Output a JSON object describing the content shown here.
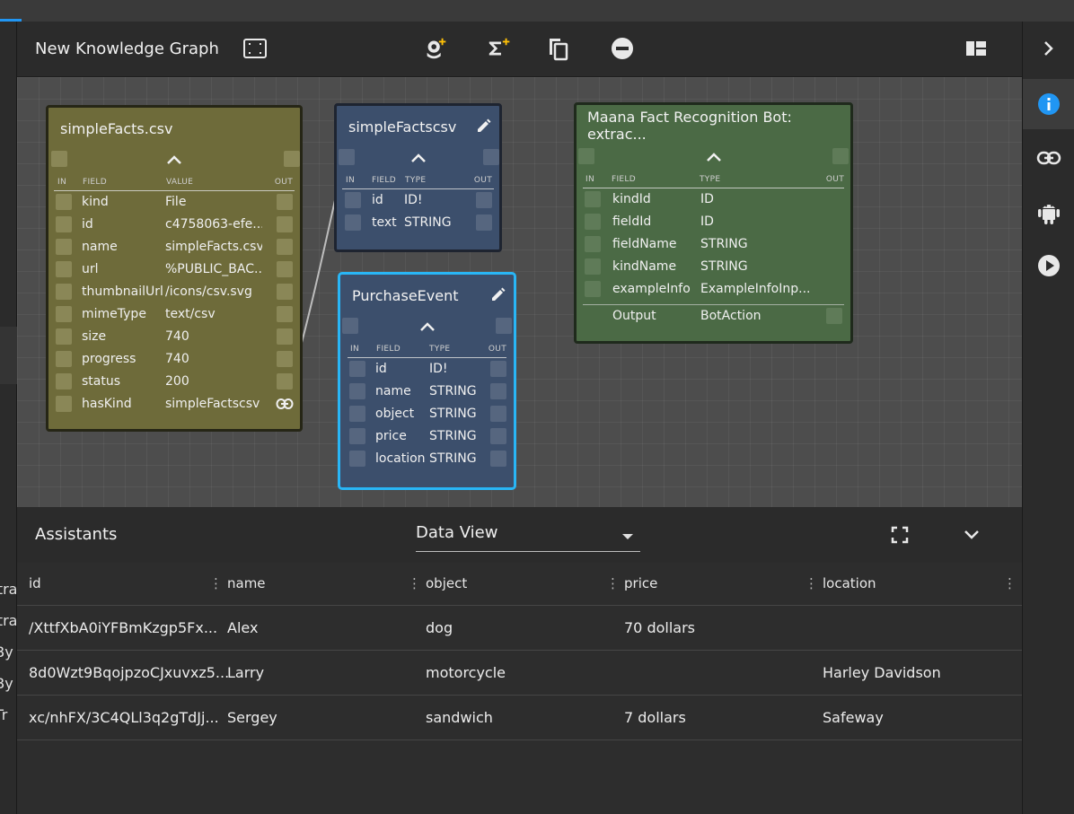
{
  "toolbar": {
    "title": "New Knowledge Graph"
  },
  "nodes": {
    "simple_facts": {
      "title": "simpleFacts.csv",
      "col_in": "IN",
      "col_field": "FIELD",
      "col_value": "VALUE",
      "col_out": "OUT",
      "rows": [
        {
          "field": "kind",
          "value": "File"
        },
        {
          "field": "id",
          "value": "c4758063-efe..."
        },
        {
          "field": "name",
          "value": "simpleFacts.csv"
        },
        {
          "field": "url",
          "value": "%PUBLIC_BAC..."
        },
        {
          "field": "thumbnailUrl",
          "value": "/icons/csv.svg"
        },
        {
          "field": "mimeType",
          "value": "text/csv"
        },
        {
          "field": "size",
          "value": "740"
        },
        {
          "field": "progress",
          "value": "740"
        },
        {
          "field": "status",
          "value": "200"
        },
        {
          "field": "hasKind",
          "value": "simpleFactscsv"
        }
      ]
    },
    "simple_factscsv": {
      "title": "simpleFactscsv",
      "col_in": "IN",
      "col_field": "FIELD",
      "col_type": "TYPE",
      "col_out": "OUT",
      "rows": [
        {
          "field": "id",
          "type": "ID!"
        },
        {
          "field": "text",
          "type": "STRING"
        }
      ]
    },
    "purchase_event": {
      "title": "PurchaseEvent",
      "col_in": "IN",
      "col_field": "FIELD",
      "col_type": "TYPE",
      "col_out": "OUT",
      "rows": [
        {
          "field": "id",
          "type": "ID!"
        },
        {
          "field": "name",
          "type": "STRING"
        },
        {
          "field": "object",
          "type": "STRING"
        },
        {
          "field": "price",
          "type": "STRING"
        },
        {
          "field": "location",
          "type": "STRING"
        }
      ]
    },
    "maana_bot": {
      "title": "Maana Fact Recognition Bot: extrac...",
      "col_in": "IN",
      "col_field": "FIELD",
      "col_type": "TYPE",
      "col_out": "OUT",
      "rows": [
        {
          "field": "kindId",
          "type": "ID"
        },
        {
          "field": "fieldId",
          "type": "ID"
        },
        {
          "field": "fieldName",
          "type": "STRING"
        },
        {
          "field": "kindName",
          "type": "STRING"
        },
        {
          "field": "exampleInfo",
          "type": "ExampleInfoInp..."
        }
      ],
      "output_label": "Output",
      "output_type": "BotAction"
    }
  },
  "bottom": {
    "title": "Assistants",
    "view_selected": "Data View"
  },
  "table": {
    "columns": [
      "id",
      "name",
      "object",
      "price",
      "location"
    ],
    "rows": [
      {
        "id": "/XttfXbA0iYFBmKzgp5Fx...",
        "name": "Alex",
        "object": "dog",
        "price": "70 dollars",
        "location": ""
      },
      {
        "id": "8d0Wzt9BqojpzoCJxuvxz5...",
        "name": "Larry",
        "object": "motorcycle",
        "price": "",
        "location": "Harley Davidson"
      },
      {
        "id": "xc/nhFX/3C4QLl3q2gTdJj...",
        "name": "Sergey",
        "object": "sandwich",
        "price": "7 dollars",
        "location": "Safeway"
      }
    ]
  },
  "left_panel": {
    "fragments": [
      "ctra",
      "ctra",
      "tBy",
      "tBy",
      "tTr"
    ]
  },
  "colors": {
    "accent": "#2196f3",
    "selected_border": "#29b6f6",
    "add_badge": "#ffc107",
    "info_icon": "#2196f3"
  }
}
